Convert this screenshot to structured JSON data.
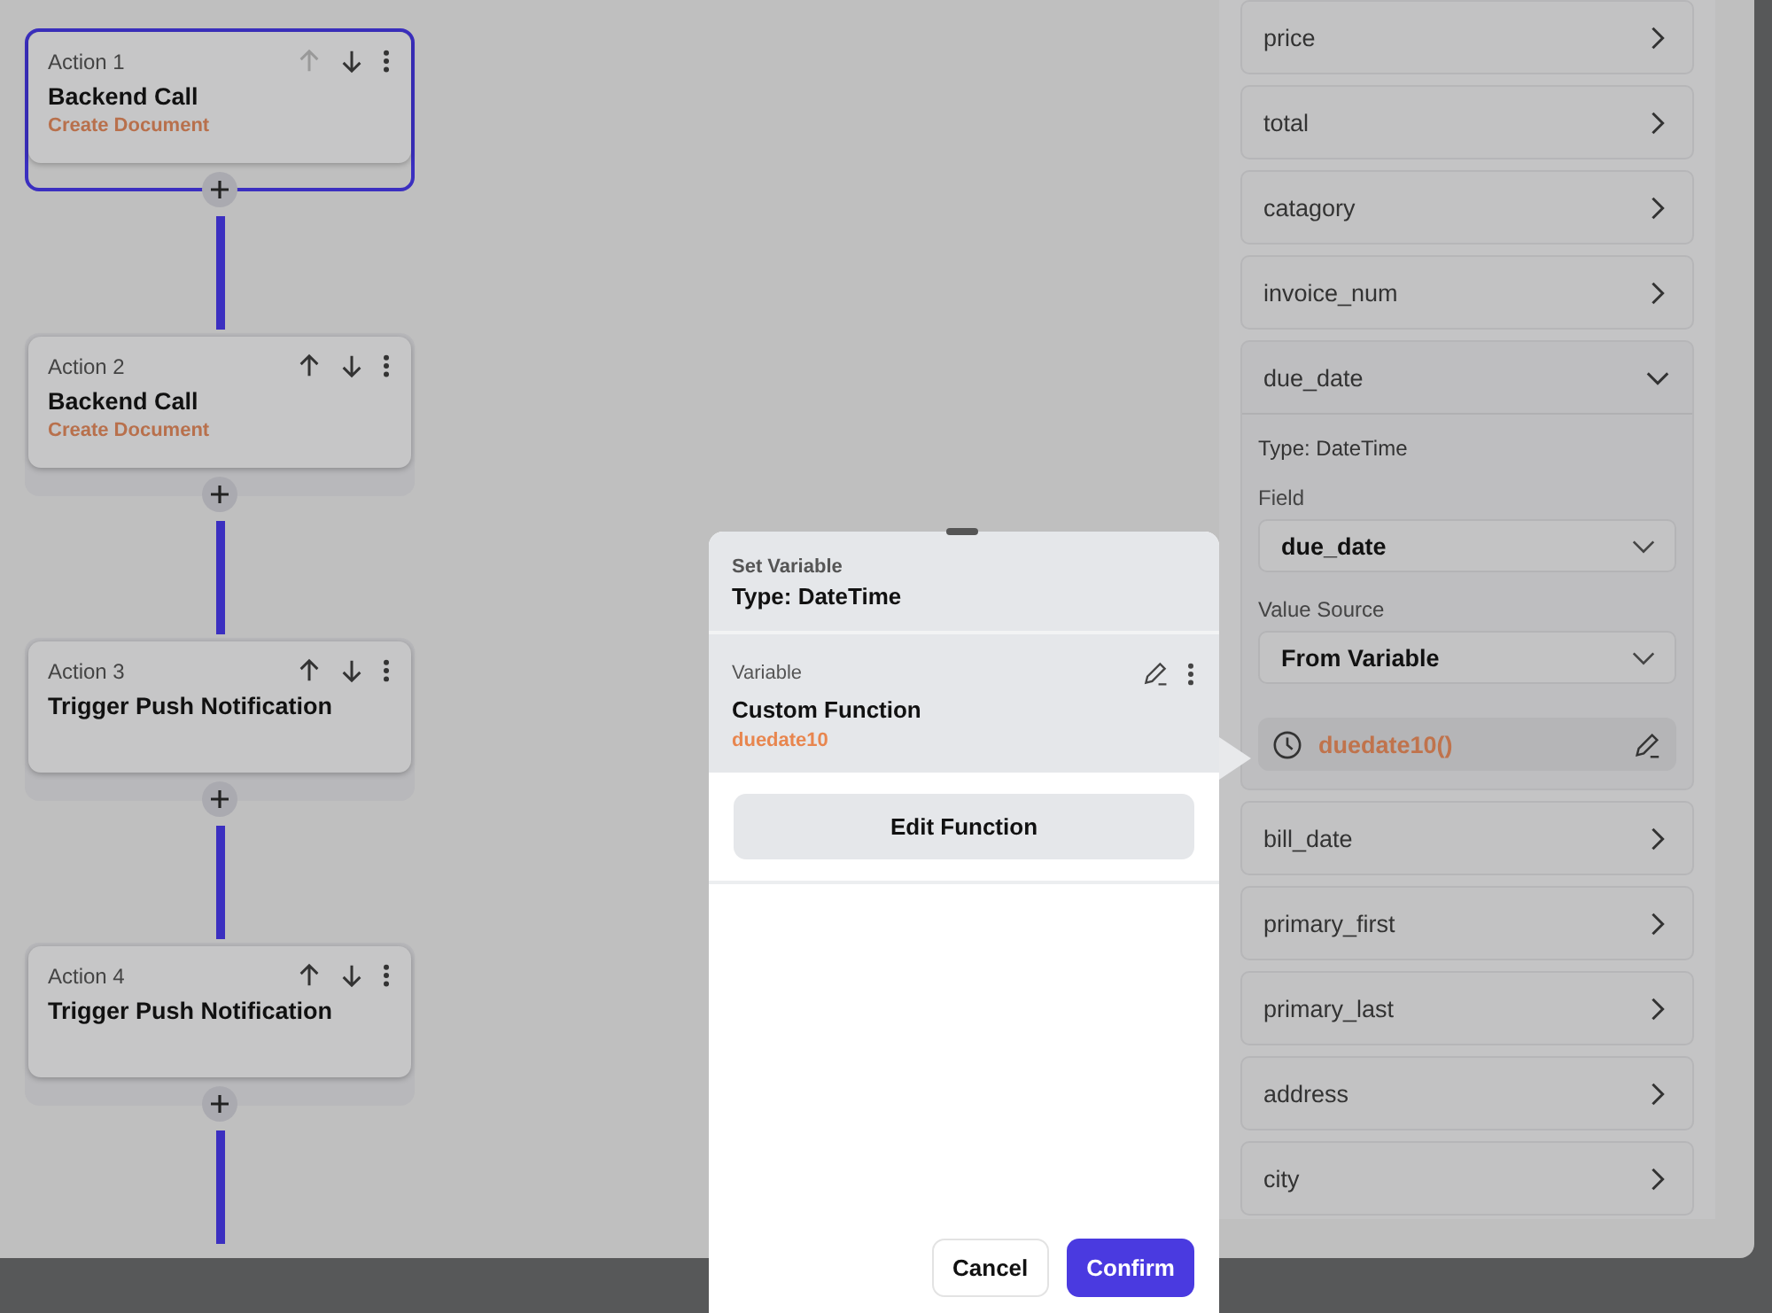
{
  "actions": [
    {
      "label": "Action 1",
      "title": "Backend Call",
      "subtitle": "Create Document",
      "selected": true,
      "up_disabled": true
    },
    {
      "label": "Action 2",
      "title": "Backend Call",
      "subtitle": "Create Document",
      "selected": false,
      "up_disabled": false
    },
    {
      "label": "Action 3",
      "title": "Trigger Push Notification",
      "selected": false,
      "up_disabled": false
    },
    {
      "label": "Action 4",
      "title": "Trigger Push Notification",
      "selected": false,
      "up_disabled": false
    }
  ],
  "fields": [
    {
      "name": "price",
      "expanded": false
    },
    {
      "name": "total",
      "expanded": false
    },
    {
      "name": "catagory",
      "expanded": false
    },
    {
      "name": "invoice_num",
      "expanded": false
    },
    {
      "name": "due_date",
      "expanded": true,
      "type": "Type: DateTime",
      "field_label": "Field",
      "field_value": "due_date",
      "source_label": "Value Source",
      "source_value": "From Variable",
      "variable": "duedate10()"
    },
    {
      "name": "bill_date",
      "expanded": false
    },
    {
      "name": "primary_first",
      "expanded": false
    },
    {
      "name": "primary_last",
      "expanded": false
    },
    {
      "name": "address",
      "expanded": false
    },
    {
      "name": "city",
      "expanded": false
    }
  ],
  "modal": {
    "kicker": "Set Variable",
    "title": "Type: DateTime",
    "variable_label": "Variable",
    "variable_title": "Custom Function",
    "variable_name": "duedate10",
    "edit_button": "Edit Function",
    "cancel": "Cancel",
    "confirm": "Confirm"
  }
}
